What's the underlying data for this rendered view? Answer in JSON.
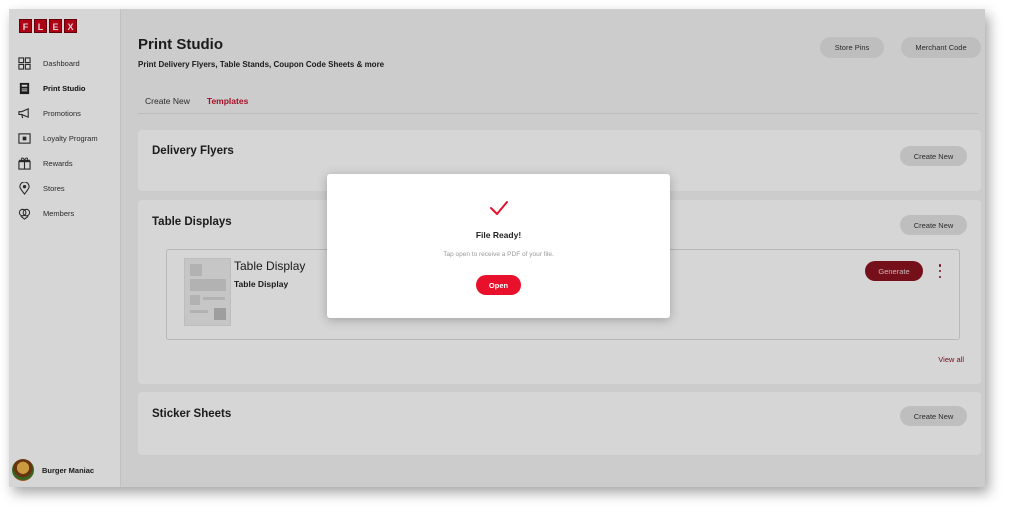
{
  "brand": {
    "logo_letters": [
      "F",
      "L",
      "E",
      "X"
    ],
    "accent_color": "#d0021b"
  },
  "sidebar": {
    "items": [
      {
        "label": "Dashboard",
        "icon": "dashboard-icon",
        "active": false
      },
      {
        "label": "Print Studio",
        "icon": "print-icon",
        "active": true
      },
      {
        "label": "Promotions",
        "icon": "megaphone-icon",
        "active": false
      },
      {
        "label": "Loyalty Program",
        "icon": "loyalty-card-icon",
        "active": false
      },
      {
        "label": "Rewards",
        "icon": "gift-icon",
        "active": false
      },
      {
        "label": "Stores",
        "icon": "location-pin-icon",
        "active": false
      },
      {
        "label": "Members",
        "icon": "members-icon",
        "active": false
      }
    ],
    "account": {
      "name": "Burger Maniac"
    }
  },
  "header": {
    "title": "Print Studio",
    "subtitle": "Print Delivery Flyers, Table Stands, Coupon Code Sheets & more",
    "store_pins_label": "Store Pins",
    "merchant_code_label": "Merchant Code"
  },
  "tabs": [
    {
      "label": "Create New",
      "active": false
    },
    {
      "label": "Templates",
      "active": true
    }
  ],
  "sections": {
    "delivery_flyers": {
      "title": "Delivery Flyers",
      "create_label": "Create New"
    },
    "table_displays": {
      "title": "Table Displays",
      "create_label": "Create New",
      "template": {
        "title": "Table Display",
        "subtitle": "Table Display",
        "generate_label": "Generate"
      },
      "view_all_label": "View all"
    },
    "sticker_sheets": {
      "title": "Sticker Sheets",
      "create_label": "Create New"
    }
  },
  "modal": {
    "icon": "checkmark-icon",
    "title": "File Ready!",
    "message": "Tap open to receive a PDF of your file.",
    "open_label": "Open"
  }
}
